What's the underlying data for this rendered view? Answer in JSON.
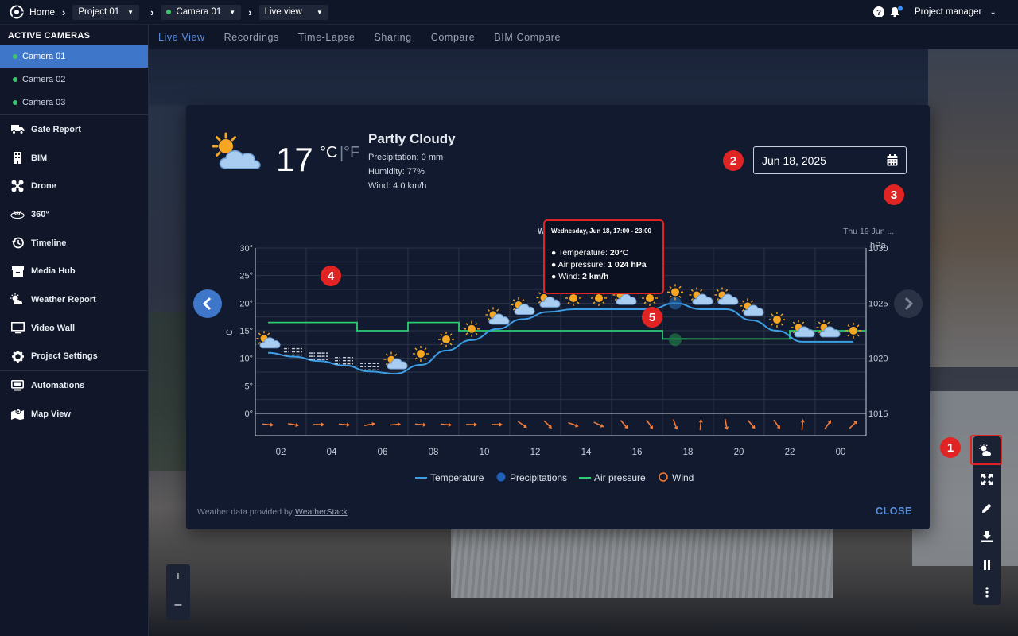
{
  "topbar": {
    "home": "Home",
    "project": "Project 01",
    "camera": "Camera 01",
    "view": "Live view",
    "user": "Project manager"
  },
  "sidebar": {
    "heading": "ACTIVE CAMERAS",
    "cameras": [
      "Camera 01",
      "Camera 02",
      "Camera 03"
    ],
    "items": [
      {
        "label": "Gate Report",
        "icon": "truck-icon"
      },
      {
        "label": "BIM",
        "icon": "building-icon"
      },
      {
        "label": "Drone",
        "icon": "drone-icon"
      },
      {
        "label": "360°",
        "icon": "360-icon"
      },
      {
        "label": "Timeline",
        "icon": "history-icon"
      },
      {
        "label": "Media Hub",
        "icon": "archive-icon"
      },
      {
        "label": "Weather Report",
        "icon": "weather-icon"
      },
      {
        "label": "Video Wall",
        "icon": "monitor-icon"
      },
      {
        "label": "Project Settings",
        "icon": "gear-icon"
      },
      {
        "label": "Automations",
        "icon": "automation-icon"
      },
      {
        "label": "Map View",
        "icon": "map-icon"
      }
    ]
  },
  "tabs": [
    "Live View",
    "Recordings",
    "Time-Lapse",
    "Sharing",
    "Compare",
    "BIM Compare"
  ],
  "weather": {
    "temp": "17",
    "unit_c": "°C",
    "unit_sep": "|",
    "unit_f": "°F",
    "condition": "Partly Cloudy",
    "precipitation": "Precipitation: 0 mm",
    "humidity": "Humidity: 77%",
    "wind": "Wind: 4.0 km/h",
    "date": "Jun 18, 2025",
    "provided_prefix": "Weather data provided by ",
    "provided_link": "WeatherStack",
    "close": "CLOSE"
  },
  "badges": [
    "1",
    "2",
    "3",
    "4",
    "5"
  ],
  "tooltip": {
    "title": "Wednesday, Jun 18, 17:00 - 23:00",
    "rows": [
      {
        "label": "Temperature: ",
        "value": "20°C"
      },
      {
        "label": "Air pressure: ",
        "value": "1 024 hPa"
      },
      {
        "label": "Wind: ",
        "value": "2 km/h"
      }
    ]
  },
  "chart_data": {
    "type": "line",
    "x_tick_labels": [
      "02",
      "04",
      "06",
      "08",
      "10",
      "12",
      "14",
      "16",
      "18",
      "20",
      "22",
      "00"
    ],
    "y_left_ticks": [
      "0°",
      "5°",
      "10°",
      "15°",
      "20°",
      "25°",
      "30°"
    ],
    "y_right_ticks": [
      "1015",
      "1020",
      "1025",
      "1030"
    ],
    "y_left_label": "C",
    "y_right_label": "hPa",
    "day_labels": [
      "W",
      "Thu 19 Jun ..."
    ],
    "ylim_left": [
      0,
      30
    ],
    "ylim_right": [
      1015,
      1030
    ],
    "hours": [
      1,
      2,
      3,
      4,
      5,
      6,
      7,
      8,
      9,
      10,
      11,
      12,
      13,
      14,
      15,
      16,
      17,
      18,
      19,
      20,
      21,
      22,
      23,
      24
    ],
    "series": [
      {
        "name": "Temperature",
        "color": "#3d9ee6",
        "axis": "left",
        "values": [
          11,
          10.3,
          9.5,
          8.7,
          7.6,
          7.2,
          8.8,
          11.4,
          13.3,
          15.3,
          17.1,
          18.4,
          18.9,
          18.9,
          18.9,
          18.9,
          20,
          18.9,
          18.9,
          16.9,
          15,
          13,
          13,
          13
        ]
      },
      {
        "name": "Air pressure",
        "color": "#2ecc71",
        "axis": "left",
        "values": [
          16.5,
          16.5,
          16.5,
          16.5,
          15,
          15,
          16.5,
          16.5,
          15,
          15,
          15,
          15,
          15,
          15,
          15,
          15,
          13.5,
          13.5,
          13.5,
          13.5,
          13.5,
          15,
          15,
          15
        ]
      },
      {
        "name": "Precipitations",
        "color": "#1f5fb5",
        "axis": "left"
      },
      {
        "name": "Wind",
        "color": "#f07b3a",
        "axis": "none"
      }
    ],
    "wind_directions_deg": [
      95,
      100,
      90,
      95,
      80,
      85,
      95,
      95,
      90,
      90,
      125,
      135,
      110,
      115,
      140,
      145,
      160,
      5,
      170,
      140,
      145,
      5,
      35,
      45
    ],
    "icons": [
      "cloud-sun-small",
      "fog",
      "fog",
      "fog",
      "fog",
      "cloud-sun",
      "sun",
      "sun",
      "sun",
      "cloud-sun",
      "cloud-sun",
      "cloud-sun",
      "sun",
      "sun",
      "cloud-sun",
      "sun",
      "sun",
      "cloud-sun",
      "cloud-sun",
      "cloud-sun",
      "sun",
      "cloud-sun",
      "cloud-sun",
      "sun"
    ],
    "legend": [
      "Temperature",
      "Precipitations",
      "Air pressure",
      "Wind"
    ]
  }
}
